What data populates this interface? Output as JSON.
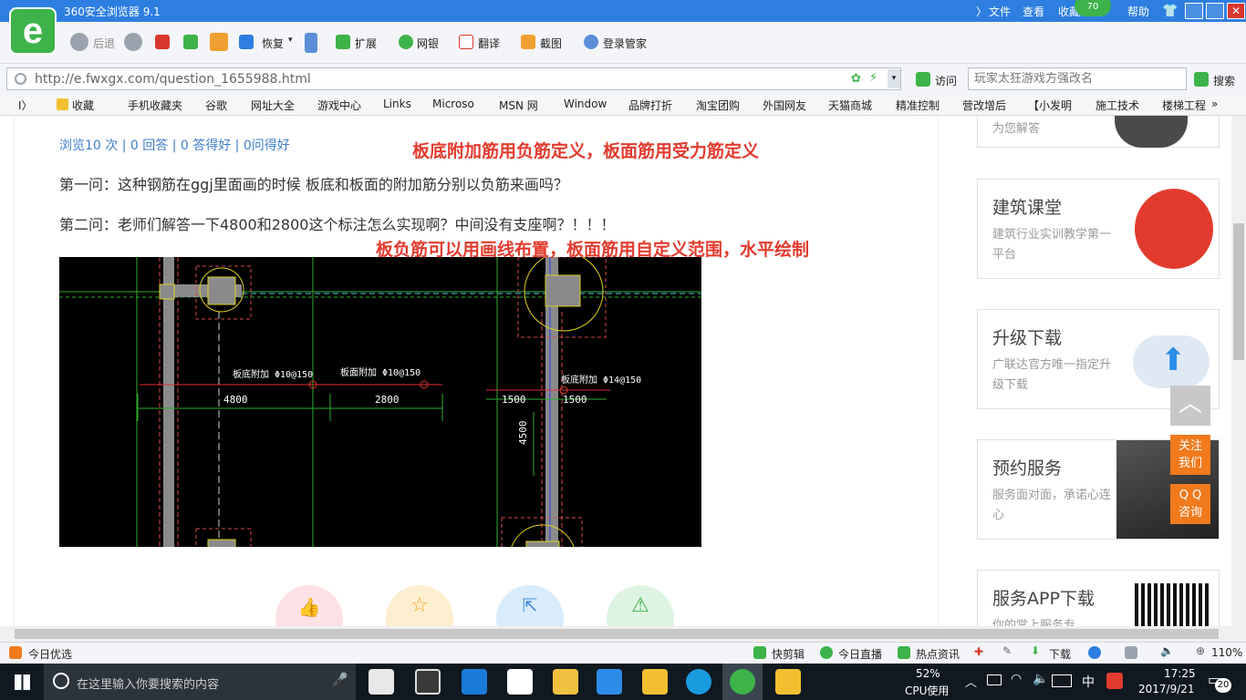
{
  "window": {
    "title": "360安全浏览器 9.1",
    "menus": [
      "文件",
      "查看",
      "收藏",
      "帮助"
    ],
    "badge": "70"
  },
  "nav": {
    "back": "后退",
    "restore": "恢复",
    "ext": "扩展",
    "bank": "网银",
    "translate": "翻译",
    "screenshot": "截图",
    "butler": "登录管家"
  },
  "address": {
    "url": "http://e.fwxgx.com/question_1655988.html",
    "visit": "访问",
    "search_placeholder": "玩家太狂游戏方强改名",
    "search_btn": "搜索"
  },
  "favorites": [
    "收藏",
    "手机收藏夹",
    "谷歌",
    "网址大全",
    "游戏中心",
    "Links",
    "Microso",
    "MSN 网",
    "Window",
    "品牌打折",
    "淘宝团购",
    "外国网友",
    "天猫商城",
    "精准控制",
    "营改增后",
    "【小发明",
    "施工技术",
    "楼梯工程"
  ],
  "page": {
    "stats": "浏览10 次 | 0 回答 | 0 答得好 | 0问得好",
    "q1": "第一问：这种钢筋在ggj里面画的时候 板底和板面的附加筋分别以负筋来画吗？",
    "q2": "第二问：老师们解答一下4800和2800这个标注怎么实现啊？中间没有支座啊？！！！",
    "annot1": "板底附加筋用负筋定义，板面筋用受力筋定义",
    "annot2": "板负筋可以用画线布置，板面筋用自定义范围，水平绘制",
    "cad": {
      "l1": "板底附加 Φ10@150",
      "l2": "板面附加 Φ10@150",
      "l3": "板底附加 Φ14@150",
      "d1": "4800",
      "d2": "2800",
      "d3": "1500",
      "d4": "1500",
      "d5": "4500"
    }
  },
  "sidebar": {
    "top_snippet": "为您解答",
    "cards": [
      {
        "title": "建筑课堂",
        "sub": "建筑行业实训教学第一平台"
      },
      {
        "title": "升级下载",
        "sub": "广联达官方唯一指定升级下载"
      },
      {
        "title": "预约服务",
        "sub": "服务面对面，承诺心连心"
      },
      {
        "title": "服务APP下载",
        "sub": "你的掌上服务专"
      }
    ],
    "float": {
      "follow": "关注我们",
      "qq": "Q Q 咨询"
    }
  },
  "status": {
    "left": "今日优选",
    "items": [
      "快剪辑",
      "今日直播",
      "热点资讯",
      "下载"
    ],
    "zoom": "110%"
  },
  "taskbar": {
    "search": "在这里输入你要搜索的内容",
    "cpu": "52%",
    "cpu_label": "CPU使用",
    "ime": "中",
    "time": "17:25",
    "date": "2017/9/21",
    "notif": "20"
  },
  "colors": {
    "titlebar": "#2d7ee0",
    "accent": "#e23b2e",
    "link": "#3f7fc9",
    "orange": "#f07a1c",
    "taskbar": "#101820"
  }
}
